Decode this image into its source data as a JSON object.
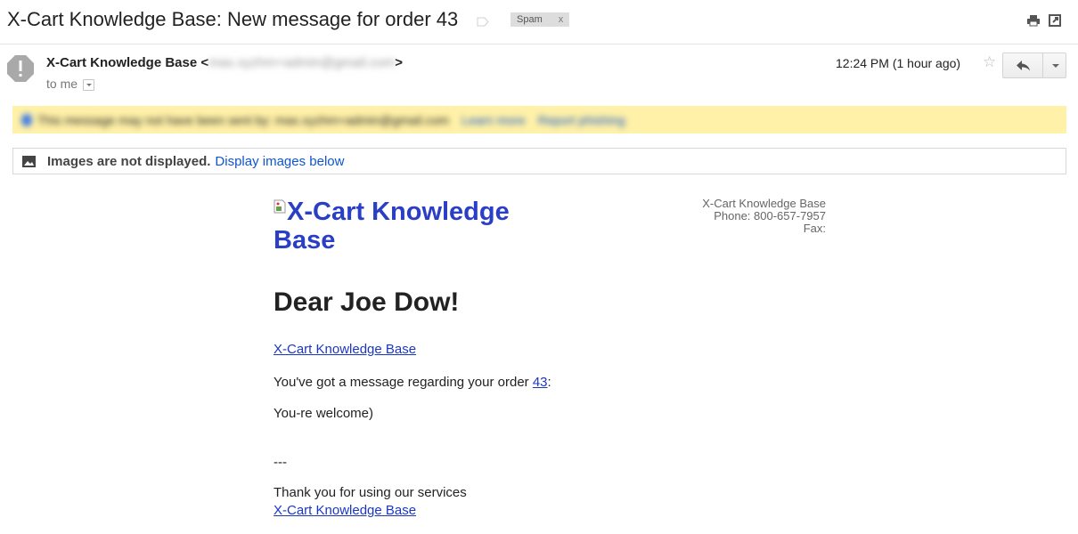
{
  "subject": "X-Cart Knowledge Base: New message for order 43",
  "label": {
    "text": "Spam",
    "remove": "x"
  },
  "sender": {
    "name": "X-Cart Knowledge Base",
    "open": "<",
    "email": "max.xyzhm+admin@gmail.com",
    "close": ">"
  },
  "recipient": "to me",
  "time": "12:24 PM (1 hour ago)",
  "star": "☆",
  "warning": {
    "text": "This message may not have been sent by: max.xyzhm+admin@gmail.com",
    "learn_more": "Learn more",
    "report": "Report phishing"
  },
  "images_notice": {
    "bold": "Images are not displayed.",
    "link": "Display images below"
  },
  "email": {
    "logo_alt": "X-Cart Knowledge Base",
    "company": {
      "name": "X-Cart Knowledge Base",
      "phone": "Phone: 800-657-7957",
      "fax": "Fax:"
    },
    "greeting": "Dear Joe Dow!",
    "store_link": "X-Cart Knowledge Base",
    "msg_prefix": "You've got a message regarding your order ",
    "order_number": "43",
    "msg_suffix": ":",
    "message": "You-re welcome)",
    "separator": "---",
    "thanks": "Thank you for using our services",
    "footer_link": "X-Cart Knowledge Base"
  },
  "colors": {
    "link": "#1b37c1",
    "gmail_link": "#1155cc",
    "warning_bg": "#fff1a8",
    "label_bg": "#dddddd"
  }
}
